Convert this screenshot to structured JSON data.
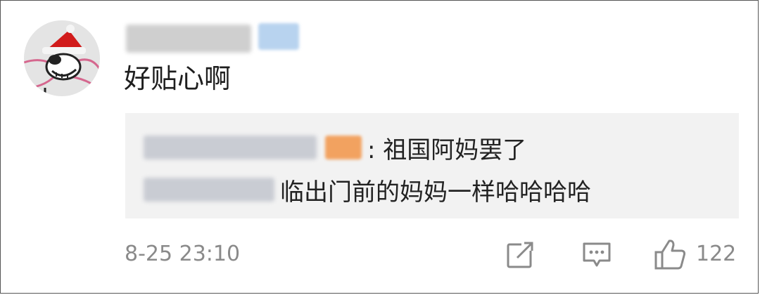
{
  "comment": {
    "author_avatar": "santa-hat-cartoon-avatar",
    "text": "好贴心啊"
  },
  "replies": [
    {
      "separator_text": ": 祖国阿妈罢了"
    },
    {
      "text": "临出门前的妈妈一样哈哈哈哈"
    }
  ],
  "footer": {
    "timestamp": "8-25 23:10",
    "share_icon": "share-icon",
    "comment_icon": "comment-icon",
    "like_icon": "like-icon",
    "like_count": "122"
  },
  "colors": {
    "background": "#ffffff",
    "reply_background": "#f2f2f2",
    "secondary_text": "#8a8a8a",
    "primary_text": "#1e1e1e"
  }
}
